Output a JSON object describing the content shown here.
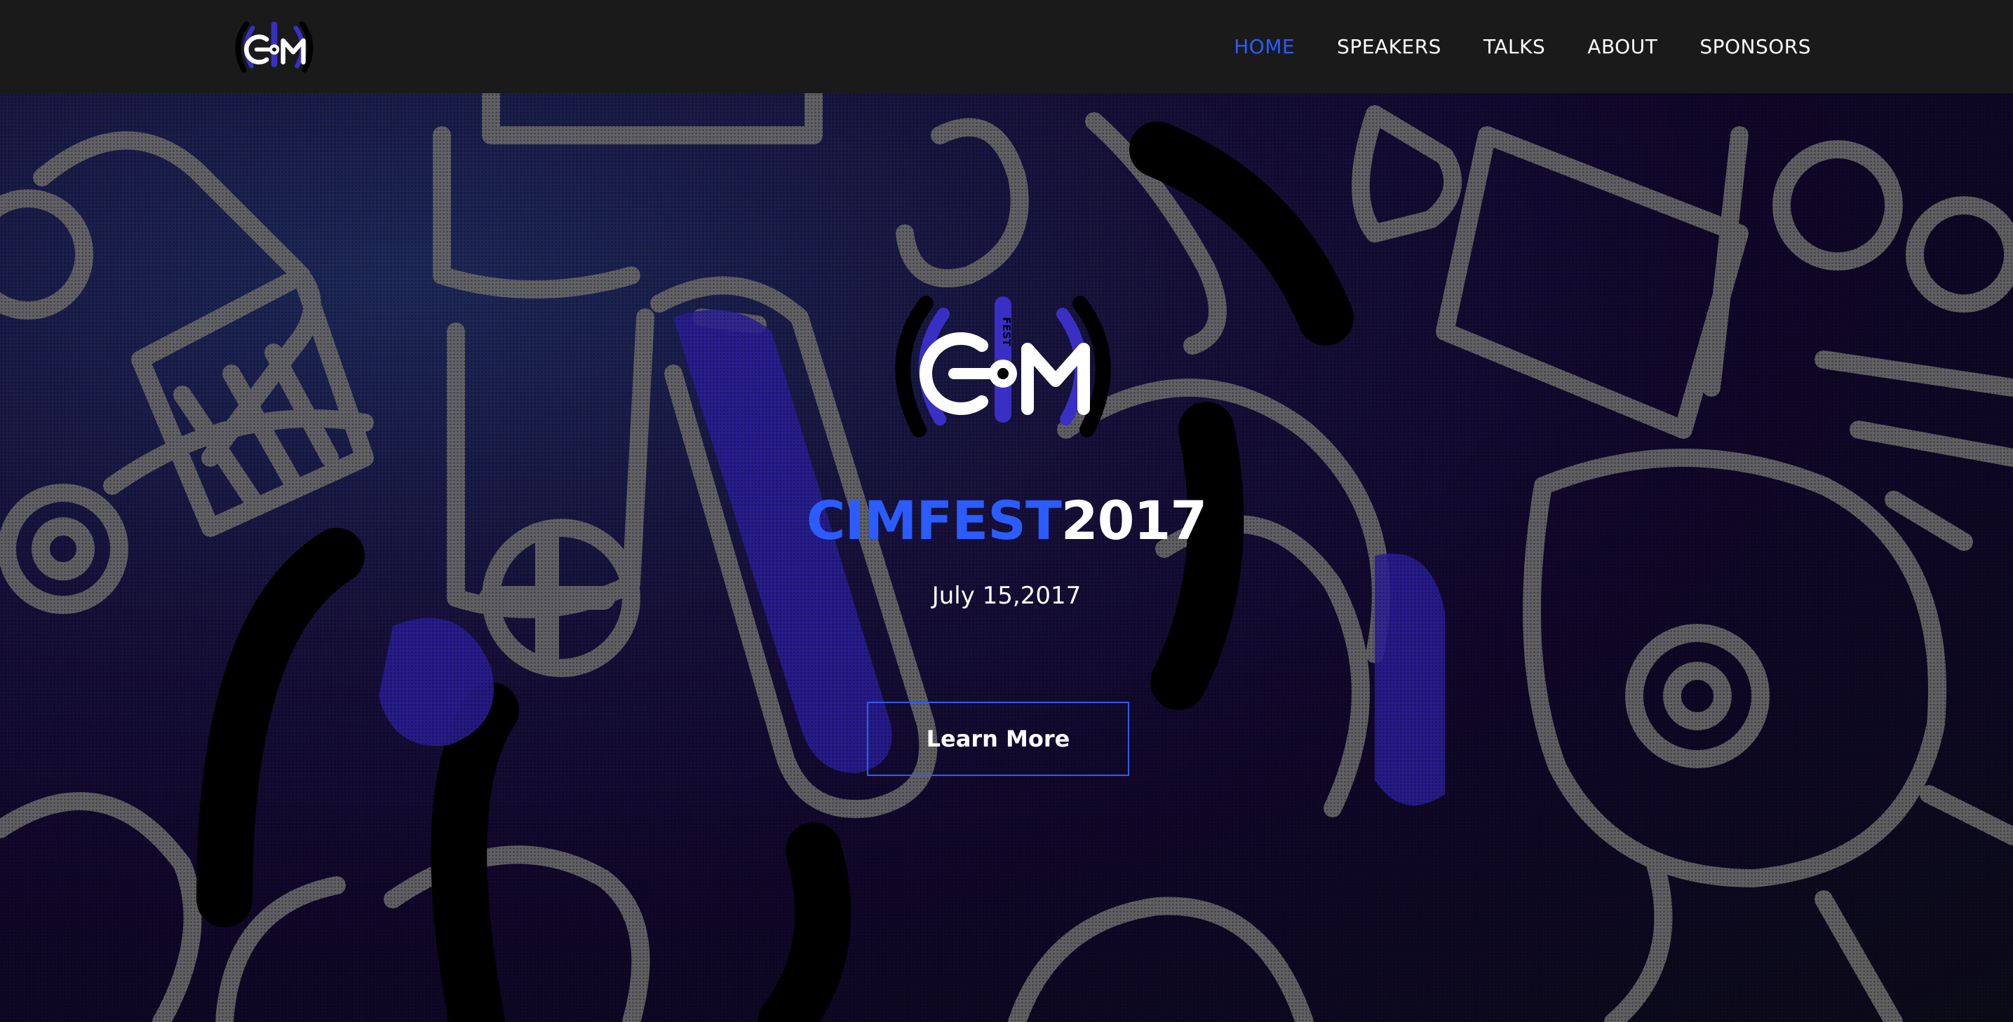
{
  "nav": {
    "logo_alt": "CIM FEST logo",
    "items": [
      {
        "label": "HOME",
        "active": true
      },
      {
        "label": "SPEAKERS",
        "active": false
      },
      {
        "label": "TALKS",
        "active": false
      },
      {
        "label": "ABOUT",
        "active": false
      },
      {
        "label": "SPONSORS",
        "active": false
      }
    ]
  },
  "hero": {
    "logo_label": "FEST",
    "title_accent": "CIMFEST",
    "title_year": "2017",
    "date": "July 15,2017",
    "cta_label": "Learn More"
  },
  "colors": {
    "accent": "#2b5cff",
    "navbar_bg": "#1a1a1a",
    "text": "#ffffff",
    "logo_purple": "#3a2fc4"
  },
  "icons": {
    "nav_logo": "cim-fest-logo-icon",
    "hero_logo": "cim-fest-logo-icon"
  }
}
